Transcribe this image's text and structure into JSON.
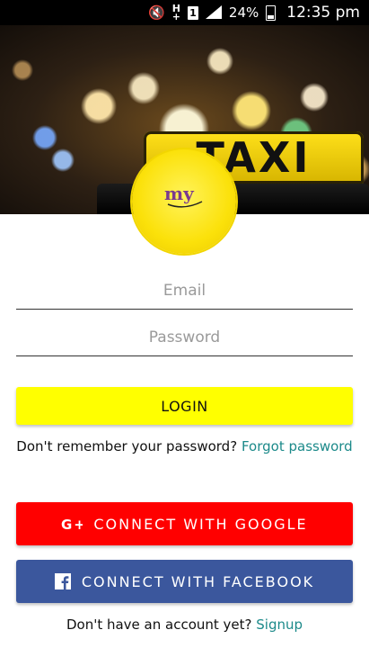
{
  "status_bar": {
    "network": "H",
    "sim": "1",
    "battery": "24%",
    "time": "12:35 pm"
  },
  "hero": {
    "sign_text": "TAXI"
  },
  "logo": {
    "text": "my"
  },
  "form": {
    "email_placeholder": "Email",
    "password_placeholder": "Password",
    "login_label": "LOGIN"
  },
  "forgot": {
    "prompt": "Don't remember your password?",
    "link": "Forgot password"
  },
  "social": {
    "google_label": "CONNECT WITH GOOGLE",
    "facebook_label": "CONNECT WITH FACEBOOK",
    "google_color": "#ff0000",
    "facebook_color": "#3b579d"
  },
  "signup": {
    "prompt": "Don't have an account yet?",
    "link": "Signup"
  },
  "colors": {
    "accent_yellow": "#ffff00",
    "link_teal": "#1c8a8a"
  }
}
